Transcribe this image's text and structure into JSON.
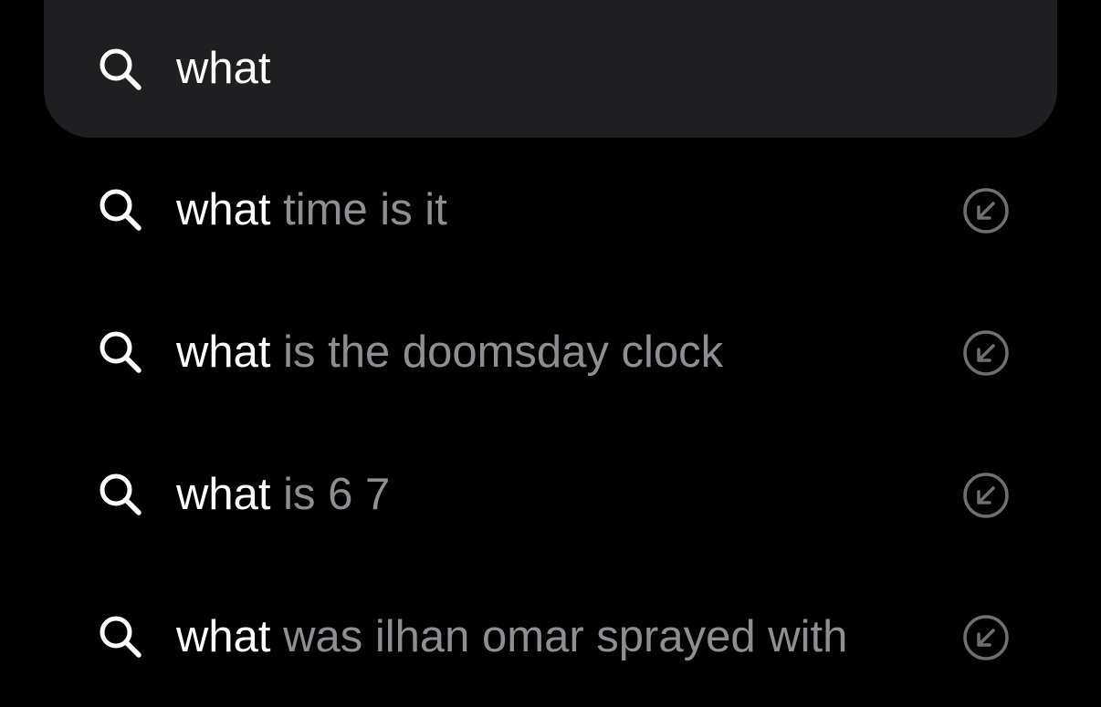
{
  "search": {
    "query": "what"
  },
  "suggestions": [
    {
      "prefix": "what",
      "rest": " time is it"
    },
    {
      "prefix": "what",
      "rest": " is the doomsday clock"
    },
    {
      "prefix": "what",
      "rest": " is 6 7"
    },
    {
      "prefix": "what",
      "rest": " was ilhan omar sprayed with"
    }
  ],
  "icons": {
    "search": "search-icon",
    "fill": "arrow-up-left-circle-icon"
  },
  "colors": {
    "background": "#000000",
    "search_bar": "#1f1f21",
    "typed_text": "#ffffff",
    "completion_text": "#8e8e93",
    "fill_icon": "#6e6e73"
  }
}
